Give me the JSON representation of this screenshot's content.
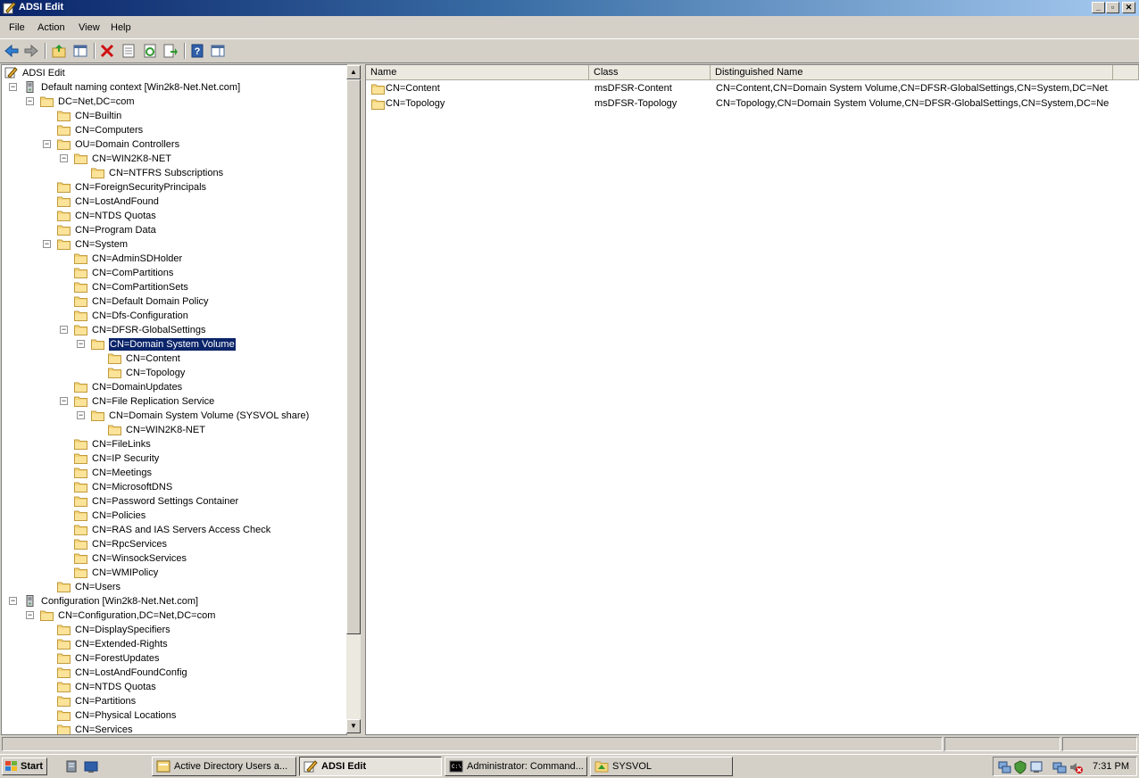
{
  "window": {
    "title": "ADSI Edit"
  },
  "menu": [
    "File",
    "Action",
    "View",
    "Help"
  ],
  "toolbar_icons": [
    "back-icon",
    "forward-icon",
    "up-folder-icon",
    "show-hide-tree-icon",
    "delete-icon",
    "properties-icon",
    "refresh-icon",
    "export-list-icon",
    "help-icon",
    "show-action-pane-icon"
  ],
  "tree": [
    {
      "label": "ADSI Edit",
      "depth": 0,
      "expander": "",
      "icon": "adsi"
    },
    {
      "label": "Default naming context [Win2k8-Net.Net.com]",
      "depth": 1,
      "expander": "−",
      "icon": "server"
    },
    {
      "label": "DC=Net,DC=com",
      "depth": 2,
      "expander": "−",
      "icon": "folder"
    },
    {
      "label": "CN=Builtin",
      "depth": 3,
      "expander": "",
      "icon": "folder"
    },
    {
      "label": "CN=Computers",
      "depth": 3,
      "expander": "",
      "icon": "folder"
    },
    {
      "label": "OU=Domain Controllers",
      "depth": 3,
      "expander": "−",
      "icon": "folder"
    },
    {
      "label": "CN=WIN2K8-NET",
      "depth": 4,
      "expander": "−",
      "icon": "folder"
    },
    {
      "label": "CN=NTFRS Subscriptions",
      "depth": 5,
      "expander": "",
      "icon": "folder"
    },
    {
      "label": "CN=ForeignSecurityPrincipals",
      "depth": 3,
      "expander": "",
      "icon": "folder"
    },
    {
      "label": "CN=LostAndFound",
      "depth": 3,
      "expander": "",
      "icon": "folder"
    },
    {
      "label": "CN=NTDS Quotas",
      "depth": 3,
      "expander": "",
      "icon": "folder"
    },
    {
      "label": "CN=Program Data",
      "depth": 3,
      "expander": "",
      "icon": "folder"
    },
    {
      "label": "CN=System",
      "depth": 3,
      "expander": "−",
      "icon": "folder"
    },
    {
      "label": "CN=AdminSDHolder",
      "depth": 4,
      "expander": "",
      "icon": "folder"
    },
    {
      "label": "CN=ComPartitions",
      "depth": 4,
      "expander": "",
      "icon": "folder"
    },
    {
      "label": "CN=ComPartitionSets",
      "depth": 4,
      "expander": "",
      "icon": "folder"
    },
    {
      "label": "CN=Default Domain Policy",
      "depth": 4,
      "expander": "",
      "icon": "folder"
    },
    {
      "label": "CN=Dfs-Configuration",
      "depth": 4,
      "expander": "",
      "icon": "folder"
    },
    {
      "label": "CN=DFSR-GlobalSettings",
      "depth": 4,
      "expander": "−",
      "icon": "folder"
    },
    {
      "label": "CN=Domain System Volume",
      "depth": 5,
      "expander": "−",
      "icon": "folder",
      "selected": true
    },
    {
      "label": "CN=Content",
      "depth": 6,
      "expander": "",
      "icon": "folder"
    },
    {
      "label": "CN=Topology",
      "depth": 6,
      "expander": "",
      "icon": "folder"
    },
    {
      "label": "CN=DomainUpdates",
      "depth": 4,
      "expander": "",
      "icon": "folder"
    },
    {
      "label": "CN=File Replication Service",
      "depth": 4,
      "expander": "−",
      "icon": "folder"
    },
    {
      "label": "CN=Domain System Volume (SYSVOL share)",
      "depth": 5,
      "expander": "−",
      "icon": "folder"
    },
    {
      "label": "CN=WIN2K8-NET",
      "depth": 6,
      "expander": "",
      "icon": "folder"
    },
    {
      "label": "CN=FileLinks",
      "depth": 4,
      "expander": "",
      "icon": "folder"
    },
    {
      "label": "CN=IP Security",
      "depth": 4,
      "expander": "",
      "icon": "folder"
    },
    {
      "label": "CN=Meetings",
      "depth": 4,
      "expander": "",
      "icon": "folder"
    },
    {
      "label": "CN=MicrosoftDNS",
      "depth": 4,
      "expander": "",
      "icon": "folder"
    },
    {
      "label": "CN=Password Settings Container",
      "depth": 4,
      "expander": "",
      "icon": "folder"
    },
    {
      "label": "CN=Policies",
      "depth": 4,
      "expander": "",
      "icon": "folder"
    },
    {
      "label": "CN=RAS and IAS Servers Access Check",
      "depth": 4,
      "expander": "",
      "icon": "folder"
    },
    {
      "label": "CN=RpcServices",
      "depth": 4,
      "expander": "",
      "icon": "folder"
    },
    {
      "label": "CN=WinsockServices",
      "depth": 4,
      "expander": "",
      "icon": "folder"
    },
    {
      "label": "CN=WMIPolicy",
      "depth": 4,
      "expander": "",
      "icon": "folder"
    },
    {
      "label": "CN=Users",
      "depth": 3,
      "expander": "",
      "icon": "folder"
    },
    {
      "label": "Configuration [Win2k8-Net.Net.com]",
      "depth": 1,
      "expander": "−",
      "icon": "server"
    },
    {
      "label": "CN=Configuration,DC=Net,DC=com",
      "depth": 2,
      "expander": "−",
      "icon": "folder"
    },
    {
      "label": "CN=DisplaySpecifiers",
      "depth": 3,
      "expander": "",
      "icon": "folder"
    },
    {
      "label": "CN=Extended-Rights",
      "depth": 3,
      "expander": "",
      "icon": "folder"
    },
    {
      "label": "CN=ForestUpdates",
      "depth": 3,
      "expander": "",
      "icon": "folder"
    },
    {
      "label": "CN=LostAndFoundConfig",
      "depth": 3,
      "expander": "",
      "icon": "folder"
    },
    {
      "label": "CN=NTDS Quotas",
      "depth": 3,
      "expander": "",
      "icon": "folder"
    },
    {
      "label": "CN=Partitions",
      "depth": 3,
      "expander": "",
      "icon": "folder"
    },
    {
      "label": "CN=Physical Locations",
      "depth": 3,
      "expander": "",
      "icon": "folder"
    },
    {
      "label": "CN=Services",
      "depth": 3,
      "expander": "",
      "icon": "folder"
    }
  ],
  "list": {
    "columns": [
      "Name",
      "Class",
      "Distinguished Name"
    ],
    "rows": [
      {
        "name": "CN=Content",
        "class": "msDFSR-Content",
        "dn": "CN=Content,CN=Domain System Volume,CN=DFSR-GlobalSettings,CN=System,DC=Net..."
      },
      {
        "name": "CN=Topology",
        "class": "msDFSR-Topology",
        "dn": "CN=Topology,CN=Domain System Volume,CN=DFSR-GlobalSettings,CN=System,DC=Ne..."
      }
    ]
  },
  "taskbar": {
    "start_label": "Start",
    "buttons": [
      {
        "label": "Active Directory Users a...",
        "active": false
      },
      {
        "label": "ADSI Edit",
        "active": true
      },
      {
        "label": "Administrator: Command...",
        "active": false
      },
      {
        "label": "SYSVOL",
        "active": false
      }
    ],
    "clock": "7:31 PM"
  },
  "colors": {
    "selection": "#0a246a",
    "folder": "#f5d67b",
    "titlebar_start": "#0a246a",
    "titlebar_end": "#a6caf0"
  }
}
